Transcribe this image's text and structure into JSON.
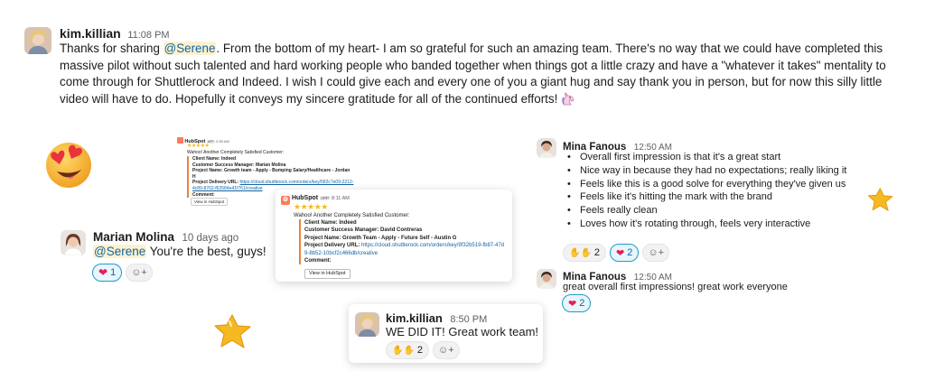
{
  "top_message": {
    "author": "kim.killian",
    "time": "11:08 PM",
    "text_before": "Thanks for sharing ",
    "mention": "@Serene",
    "text_after": ". From the bottom of my heart- I am so grateful for such an amazing team. There's no way that we could have completed this massive pilot without such talented and hard working people who banded together when things got a little crazy and have a \"whatever it takes\" mentality to come through for Shuttlerock and Indeed. I wish I could give each and every one of you a giant hug and say thank you in person, but for now this silly little video will have to do. Hopefully it conveys my sincere gratitude for all of the continued efforts!",
    "emoji": "unicorn"
  },
  "hubspot_small": {
    "app": "HubSpot",
    "badge": "APP",
    "time": "2:59 AM",
    "intro": "Wahoo! Another Completely Satisfied Customer:",
    "client": "Client Name: Indeed",
    "csm": "Customer Success Manager: Marian Molina",
    "project": "Project Name: Growth team - Apply - Bumping Salary/Healthcare - Jordan H",
    "url_label": "Project Delivery URL: ",
    "url": "https://cloud.shuttlerock.com/orders/key/582c7e09-2212-4c89-8762-f62584e41f761/creative",
    "comment": "Comment:",
    "button": "View in HubSpot"
  },
  "hubspot_large": {
    "app": "HubSpot",
    "badge": "APP",
    "time": "8:11 AM",
    "intro": "Wahoo! Another Completely Satisfied Customer:",
    "client": "Client Name: Indeed",
    "csm": "Customer Success Manager: David Contreras",
    "project": "Project Name: Growth Team - Apply - Future Self - Austin G",
    "url_label": "Project Delivery URL: ",
    "url": "https://cloud.shuttlerock.com/orders/key/9f32b519-fb87-47d9-8b52-10bcf2c466db/creative",
    "comment": "Comment:",
    "button": "View in HubSpot"
  },
  "marian": {
    "author": "Marian Molina",
    "time": "10 days ago",
    "mention": "@Serene",
    "text": " You're the best, guys!",
    "reaction_count": "1"
  },
  "mina_first": {
    "author": "Mina Fanous",
    "time": "12:50 AM",
    "bullets": [
      "Overall first impression is that it's a great start",
      "Nice way in because they had no expectations; really liking it",
      "Feels like this is a good solve for everything they've given us",
      "Feels like it's hitting the mark with the brand",
      "Feels really clean",
      "Loves how it's rotating through, feels very interactive"
    ],
    "reaction_clap_count": "2",
    "reaction_heart_count": "2"
  },
  "mina_second": {
    "author": "Mina Fanous",
    "time": "12:50 AM",
    "text": "great overall first impressions! great work everyone",
    "reaction_heart_count": "2"
  },
  "kim_bottom": {
    "author": "kim.killian",
    "time": "8:50 PM",
    "text": "WE DID IT! Great work team!",
    "reaction_clap_count": "2"
  },
  "colors": {
    "mention_bg": "#fdf2cf",
    "link": "#1264a3",
    "hubspot_orange": "#ff7a59",
    "star_yellow": "#f5b921",
    "heart_red": "#e01e5a"
  },
  "icons": [
    "unicorn-icon",
    "heart-eyes-emoji",
    "star-emoji",
    "heart-icon",
    "clap-icon",
    "add-reaction-icon",
    "hubspot-logo",
    "star-rating-icon"
  ]
}
